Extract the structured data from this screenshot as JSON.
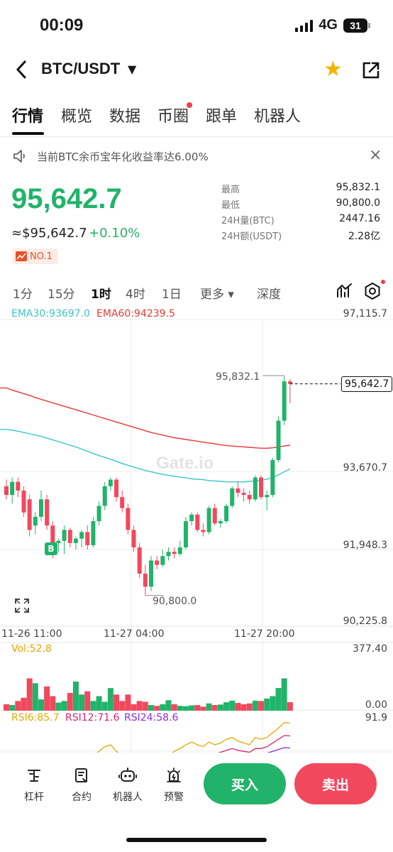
{
  "status": {
    "time": "00:09",
    "network": "4G",
    "battery": "31"
  },
  "header": {
    "pair": "BTC/USDT"
  },
  "tabs": [
    {
      "label": "行情",
      "active": true
    },
    {
      "label": "概览"
    },
    {
      "label": "数据"
    },
    {
      "label": "币圈",
      "dot": true
    },
    {
      "label": "跟单"
    },
    {
      "label": "机器人"
    }
  ],
  "notice": {
    "text": "当前BTC余币宝年化收益率达6.00%"
  },
  "price": {
    "last": "95,642.7",
    "approx": "≈$95,642.7",
    "change": "+0.10%",
    "rank": "NO.1"
  },
  "stats": [
    {
      "label": "最高",
      "value": "95,832.1"
    },
    {
      "label": "最低",
      "value": "90,800.0"
    },
    {
      "label": "24H量(BTC)",
      "value": "2447.16"
    },
    {
      "label": "24H额(USDT)",
      "value": "2.28亿"
    }
  ],
  "intervals": [
    {
      "label": "1分"
    },
    {
      "label": "15分"
    },
    {
      "label": "1时",
      "active": true
    },
    {
      "label": "4时"
    },
    {
      "label": "1日"
    },
    {
      "label": "更多 ▾"
    },
    {
      "label": "深度"
    }
  ],
  "chart": {
    "ema30": "EMA30:93697.0",
    "ema60": "EMA60:94239.5",
    "yaxis": [
      "97,115.7",
      "93,670.7",
      "91,948.3",
      "90,225.8"
    ],
    "xaxis": [
      "11-26 11:00",
      "11-27 04:00",
      "11-27 20:00"
    ],
    "high_label": "95,832.1",
    "low_label": "90,800.0",
    "last_label": "95,642.7",
    "watermark": "Gate.io",
    "vol_label": "Vol:52.8",
    "vol_max": "377.40",
    "vol_min": "0.00",
    "rsi6": "RSI6:85.7",
    "rsi12": "RSI12:71.6",
    "rsi24": "RSI24:58.6",
    "rsi_max": "91.9",
    "marker": "B",
    "colors": {
      "up": "#21b36a",
      "down": "#f2485d",
      "ema30": "#3cc6c6",
      "ema60": "#e53935"
    }
  },
  "chart_data": {
    "type": "candlestick",
    "interval": "1h",
    "ylim": [
      90225.8,
      97115.7
    ],
    "candles": [
      {
        "o": 93300,
        "h": 93450,
        "l": 93000,
        "c": 93100
      },
      {
        "o": 93100,
        "h": 93500,
        "l": 92900,
        "c": 93400
      },
      {
        "o": 93400,
        "h": 93500,
        "l": 93050,
        "c": 93200
      },
      {
        "o": 93200,
        "h": 93300,
        "l": 92600,
        "c": 92700
      },
      {
        "o": 93000,
        "h": 93100,
        "l": 92150,
        "c": 92300
      },
      {
        "o": 92400,
        "h": 92700,
        "l": 92200,
        "c": 92600
      },
      {
        "o": 92600,
        "h": 93200,
        "l": 92500,
        "c": 93000
      },
      {
        "o": 93000,
        "h": 93100,
        "l": 92300,
        "c": 92400
      },
      {
        "o": 92400,
        "h": 92500,
        "l": 91650,
        "c": 91950
      },
      {
        "o": 92000,
        "h": 92100,
        "l": 91800,
        "c": 92050
      },
      {
        "o": 92050,
        "h": 92400,
        "l": 91750,
        "c": 92300
      },
      {
        "o": 92300,
        "h": 92350,
        "l": 91900,
        "c": 92000
      },
      {
        "o": 92000,
        "h": 92150,
        "l": 91850,
        "c": 92100
      },
      {
        "o": 92100,
        "h": 92300,
        "l": 91900,
        "c": 92250
      },
      {
        "o": 92250,
        "h": 92400,
        "l": 91850,
        "c": 91950
      },
      {
        "o": 91950,
        "h": 92600,
        "l": 91900,
        "c": 92500
      },
      {
        "o": 92500,
        "h": 92950,
        "l": 92400,
        "c": 92850
      },
      {
        "o": 92850,
        "h": 93400,
        "l": 92750,
        "c": 93300
      },
      {
        "o": 93300,
        "h": 93500,
        "l": 93200,
        "c": 93450
      },
      {
        "o": 93450,
        "h": 93500,
        "l": 92950,
        "c": 93050
      },
      {
        "o": 93050,
        "h": 93200,
        "l": 92700,
        "c": 92800
      },
      {
        "o": 92800,
        "h": 92900,
        "l": 92200,
        "c": 92300
      },
      {
        "o": 92300,
        "h": 92400,
        "l": 91800,
        "c": 91900
      },
      {
        "o": 91900,
        "h": 92000,
        "l": 91200,
        "c": 91300
      },
      {
        "o": 91300,
        "h": 91500,
        "l": 90800,
        "c": 91000
      },
      {
        "o": 91000,
        "h": 91700,
        "l": 90900,
        "c": 91600
      },
      {
        "o": 91600,
        "h": 91700,
        "l": 91400,
        "c": 91500
      },
      {
        "o": 91500,
        "h": 91850,
        "l": 91450,
        "c": 91700
      },
      {
        "o": 91700,
        "h": 91900,
        "l": 91600,
        "c": 91800
      },
      {
        "o": 91800,
        "h": 91900,
        "l": 91650,
        "c": 91750
      },
      {
        "o": 91750,
        "h": 92050,
        "l": 91700,
        "c": 91900
      },
      {
        "o": 91900,
        "h": 92600,
        "l": 91850,
        "c": 92500
      },
      {
        "o": 92500,
        "h": 92700,
        "l": 92400,
        "c": 92650
      },
      {
        "o": 92650,
        "h": 92700,
        "l": 92250,
        "c": 92300
      },
      {
        "o": 92300,
        "h": 92450,
        "l": 92150,
        "c": 92250
      },
      {
        "o": 92250,
        "h": 92850,
        "l": 92200,
        "c": 92800
      },
      {
        "o": 92800,
        "h": 92900,
        "l": 92400,
        "c": 92450
      },
      {
        "o": 92450,
        "h": 92550,
        "l": 92350,
        "c": 92500
      },
      {
        "o": 92500,
        "h": 92900,
        "l": 92450,
        "c": 92850
      },
      {
        "o": 92850,
        "h": 93300,
        "l": 92800,
        "c": 93250
      },
      {
        "o": 93250,
        "h": 93400,
        "l": 93050,
        "c": 93150
      },
      {
        "o": 93150,
        "h": 93250,
        "l": 92950,
        "c": 93100
      },
      {
        "o": 93100,
        "h": 93200,
        "l": 92900,
        "c": 93000
      },
      {
        "o": 93000,
        "h": 93550,
        "l": 92950,
        "c": 93500
      },
      {
        "o": 93500,
        "h": 93550,
        "l": 93000,
        "c": 93050
      },
      {
        "o": 93050,
        "h": 93200,
        "l": 92750,
        "c": 93100
      },
      {
        "o": 93100,
        "h": 93950,
        "l": 93050,
        "c": 93900
      },
      {
        "o": 93900,
        "h": 94900,
        "l": 93850,
        "c": 94800
      },
      {
        "o": 94800,
        "h": 95832.1,
        "l": 94700,
        "c": 95700
      },
      {
        "o": 95700,
        "h": 95750,
        "l": 95200,
        "c": 95642.7
      }
    ],
    "ema30": [
      94600,
      94580,
      94560,
      94530,
      94500,
      94470,
      94440,
      94400,
      94360,
      94320,
      94280,
      94240,
      94200,
      94150,
      94100,
      94050,
      94000,
      93960,
      93920,
      93870,
      93820,
      93780,
      93740,
      93700,
      93660,
      93630,
      93600,
      93570,
      93550,
      93530,
      93510,
      93490,
      93470,
      93460,
      93450,
      93430,
      93420,
      93410,
      93400,
      93400,
      93400,
      93400,
      93410,
      93420,
      93440,
      93460,
      93500,
      93560,
      93630,
      93697
    ],
    "ema60": [
      95550,
      95500,
      95460,
      95420,
      95380,
      95330,
      95290,
      95250,
      95210,
      95170,
      95130,
      95090,
      95050,
      95010,
      94970,
      94930,
      94890,
      94850,
      94810,
      94770,
      94730,
      94690,
      94650,
      94610,
      94570,
      94530,
      94500,
      94470,
      94440,
      94410,
      94390,
      94370,
      94350,
      94330,
      94310,
      94290,
      94270,
      94250,
      94230,
      94220,
      94210,
      94200,
      94190,
      94180,
      94170,
      94170,
      94180,
      94200,
      94220,
      94239.5
    ],
    "volume": [
      40,
      35,
      60,
      80,
      200,
      170,
      70,
      150,
      90,
      50,
      60,
      110,
      180,
      100,
      120,
      60,
      90,
      55,
      140,
      100,
      60,
      100,
      40,
      60,
      55,
      35,
      30,
      40,
      65,
      40,
      30,
      28,
      33,
      35,
      25,
      45,
      35,
      38,
      52,
      62,
      48,
      40,
      45,
      62,
      60,
      75,
      90,
      140,
      200,
      52.8
    ],
    "vol_ylim": [
      0,
      377.4
    ],
    "rsi6": [
      30,
      32,
      30,
      28,
      25,
      30,
      35,
      40,
      38,
      40,
      42,
      44,
      45,
      48,
      45,
      50,
      55,
      60,
      62,
      55,
      50,
      45,
      40,
      35,
      30,
      35,
      40,
      45,
      50,
      55,
      58,
      62,
      65,
      62,
      60,
      65,
      62,
      64,
      68,
      70,
      66,
      64,
      62,
      70,
      68,
      70,
      75,
      80,
      86,
      85.7
    ],
    "rsi12": [
      28,
      29,
      28,
      27,
      26,
      28,
      30,
      32,
      33,
      34,
      35,
      36,
      37,
      38,
      37,
      40,
      42,
      45,
      46,
      44,
      42,
      40,
      38,
      36,
      35,
      37,
      39,
      41,
      43,
      45,
      47,
      50,
      52,
      51,
      50,
      52,
      52,
      54,
      56,
      58,
      56,
      55,
      54,
      58,
      58,
      60,
      64,
      68,
      72,
      71.6
    ],
    "rsi24": [
      35,
      35,
      34,
      34,
      33,
      34,
      35,
      36,
      37,
      37,
      38,
      38,
      39,
      40,
      40,
      41,
      42,
      43,
      44,
      43,
      42,
      41,
      40,
      39,
      38,
      39,
      40,
      41,
      42,
      43,
      44,
      45,
      46,
      46,
      46,
      47,
      47,
      48,
      49,
      50,
      50,
      50,
      50,
      52,
      52,
      53,
      55,
      57,
      59,
      58.6
    ],
    "rsi_ylim": [
      0,
      91.9
    ]
  },
  "bottom_nav": [
    {
      "label": "杠杆"
    },
    {
      "label": "合约"
    },
    {
      "label": "机器人"
    },
    {
      "label": "预警"
    }
  ],
  "actions": {
    "buy": "买入",
    "sell": "卖出"
  }
}
